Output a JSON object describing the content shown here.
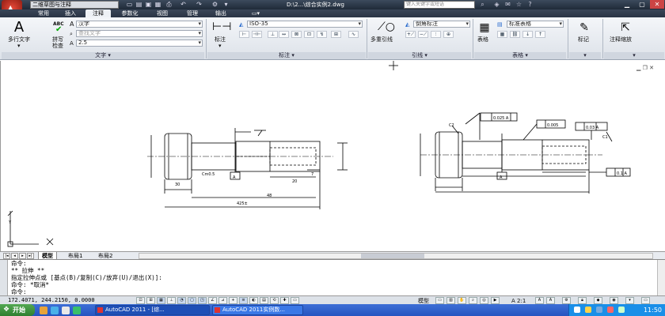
{
  "titlebar": {
    "workspace": "二维草图与注释",
    "doc_title": "D:\\2...\\综合实例2.dwg",
    "search_placeholder": "键入关键字或短语"
  },
  "tabs": [
    "常用",
    "插入",
    "注释",
    "参数化",
    "视图",
    "管理",
    "输出"
  ],
  "active_tab": "注释",
  "ribbon": {
    "text_panel": {
      "mtext_label": "多行文字",
      "spell_abc": "ABC",
      "spell_label": "拼写检查",
      "style_value": "汉字",
      "find_placeholder": "查找文字",
      "height_value": "2.5",
      "panel_title": "文字"
    },
    "dim_panel": {
      "dim_label": "标注",
      "dim_style": "ISO-35",
      "panel_title": "标注"
    },
    "leader_panel": {
      "mleader_label": "多重引线",
      "leader_style": "倒角标注",
      "panel_title": "引线"
    },
    "table_panel": {
      "table_label": "表格",
      "table_style": "标准表格",
      "panel_title": "表格"
    },
    "mark_label": "标记",
    "scale_label": "注释缩放"
  },
  "layout_tabs": [
    "模型",
    "布局1",
    "布局2"
  ],
  "active_layout": "模型",
  "command_lines": [
    "命令:",
    "** 拉伸 **",
    "指定拉伸点或 [基点(B)/复制(C)/放弃(U)/退出(X)]:",
    "命令: *取消*",
    "命令:"
  ],
  "status": {
    "coords": "172.4071, 244.2150, 0.0000",
    "model_label": "模型",
    "scale": "A 2:1"
  },
  "taskbar": {
    "start_label": "开始",
    "tasks": [
      "AutoCAD 2011 - [综...",
      "AutoCAD 2011实例数..."
    ],
    "clock": "11:50"
  },
  "drawing": {
    "left_dims": [
      "30",
      "48",
      "7",
      "20",
      "Cm0.5",
      "425±"
    ],
    "right_dims": [
      "0.025 A",
      "0.005",
      "0.03 A",
      "0.1 A",
      "C2",
      "C1"
    ],
    "datum": "A"
  }
}
